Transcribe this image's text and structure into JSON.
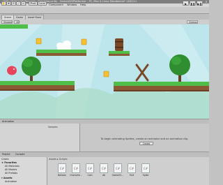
{
  "window": {
    "title": "Unity 2018.2.0f2 Personal - Gameplay.unity - GameAI2DPlatformer - PC, Mac & Linux Standalone* <DX11>",
    "controls": [
      "–",
      "□",
      "×"
    ]
  },
  "menu": [
    "File",
    "Edit",
    "Assets",
    "GameObject",
    "Component",
    "Window",
    "Help"
  ],
  "toolbar": {
    "tools": [
      "✋",
      "✥",
      "⟳",
      "⤢",
      "▭"
    ],
    "pivot_toggles": [
      "Pivot",
      "Local"
    ],
    "play_controls": [
      "▶",
      "❚❚",
      "▶❚"
    ]
  },
  "scene_tabs": [
    "Scene",
    "Game",
    "Asset Store"
  ],
  "scene_options": [
    "Shaded",
    "2D",
    "Gizmos"
  ],
  "animation": {
    "tab": "Animation",
    "samples_label": "Samples",
    "empty_message": "To begin animating Sprites, create an animator and an animation clip.",
    "create_button": "Create"
  },
  "project": {
    "tabs": [
      "Project",
      "Console"
    ],
    "create_label": "Create",
    "tree": [
      {
        "label": "★ Favorites",
        "bold": true
      },
      {
        "label": "All Materials",
        "indent": 1
      },
      {
        "label": "All Models",
        "indent": 1
      },
      {
        "label": "All Prefabs",
        "indent": 1
      },
      {
        "label": "▾ Assets",
        "bold": true
      },
      {
        "label": "Animation",
        "indent": 1
      }
    ],
    "breadcrumb": "Assets ▸ Scripts",
    "assets": [
      {
        "label": "Balloon",
        "icon": "C#"
      },
      {
        "label": "Characte...",
        "icon": "C#"
      },
      {
        "label": "Coin",
        "icon": "C#"
      },
      {
        "label": "db",
        "icon": "C#"
      },
      {
        "label": "GameCh...",
        "icon": "C#"
      },
      {
        "label": "Exit",
        "icon": "C#"
      },
      {
        "label": "Spike",
        "icon": "C#"
      }
    ]
  },
  "colors": {
    "sky": "#bde6ec",
    "grass": "#4fbf4a",
    "dirt": "#8a5a34",
    "coin": "#f7c030",
    "player": "#e8465c",
    "barrel": "#7a4a28",
    "tree_leaves": "#2f8e30"
  }
}
